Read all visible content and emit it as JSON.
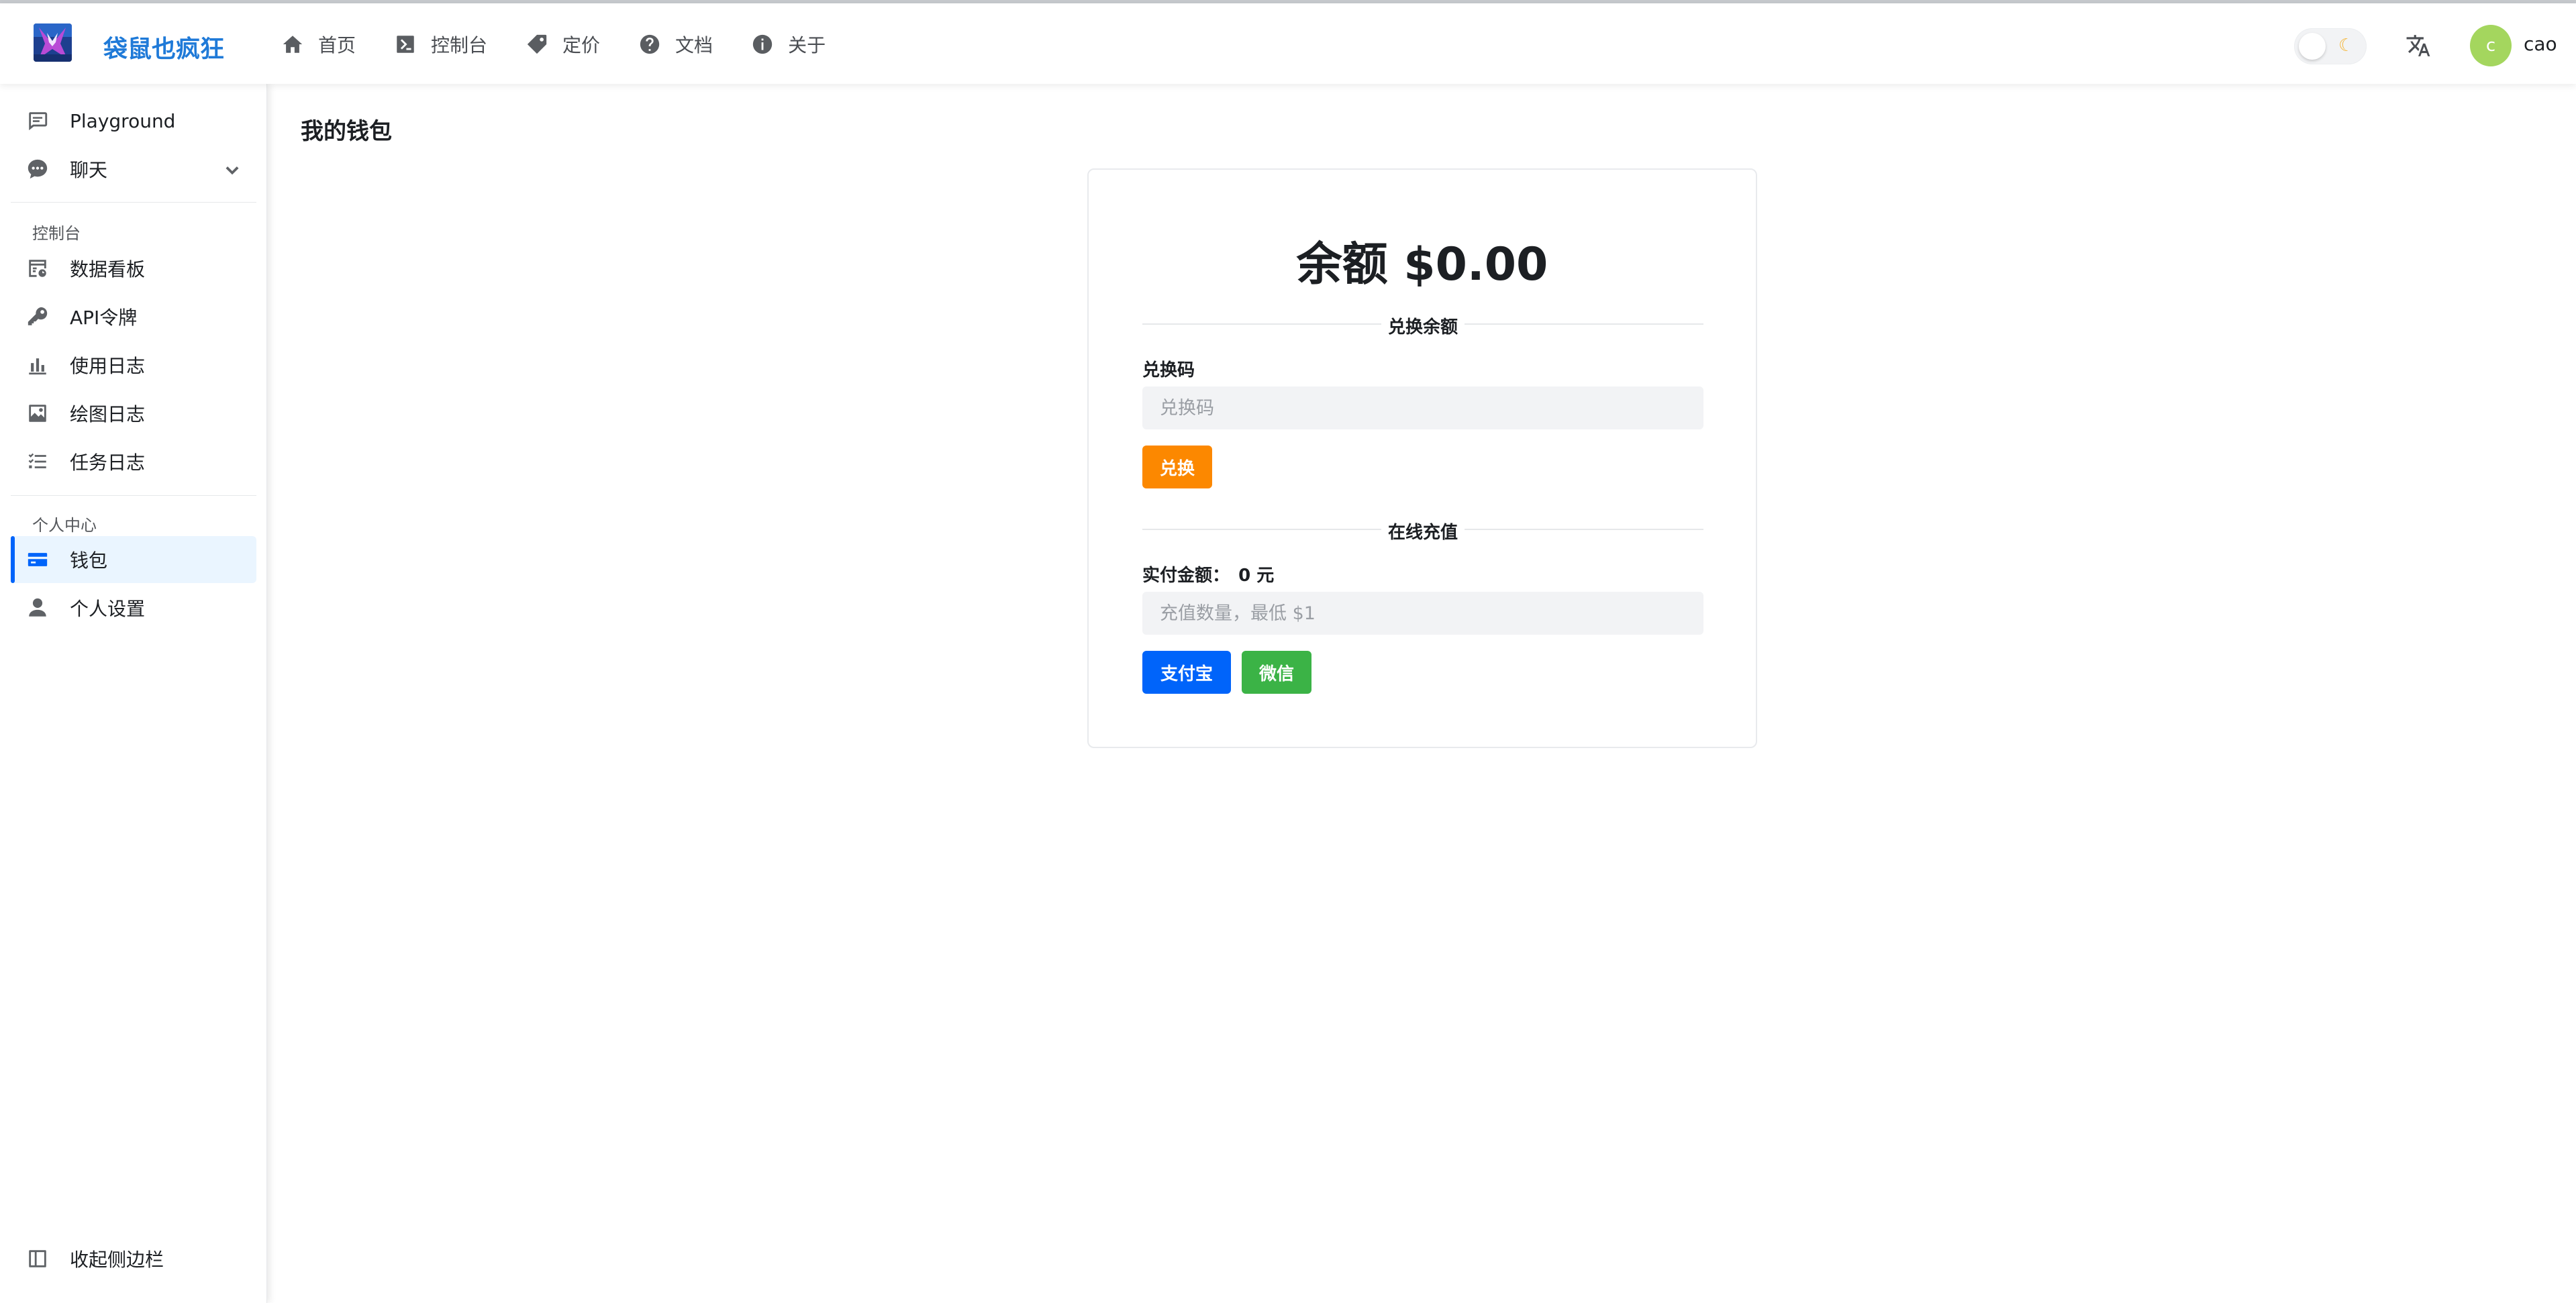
{
  "header": {
    "brand": "袋鼠也疯狂",
    "nav": [
      {
        "label": "首页",
        "icon": "home-icon"
      },
      {
        "label": "控制台",
        "icon": "terminal-icon"
      },
      {
        "label": "定价",
        "icon": "price-tag-icon"
      },
      {
        "label": "文档",
        "icon": "help-circle-icon"
      },
      {
        "label": "关于",
        "icon": "info-circle-icon"
      }
    ],
    "theme_icon": "moon-icon",
    "user": {
      "initial": "c",
      "name": "cao"
    },
    "avatar_color": "#a4d65e"
  },
  "sidebar": {
    "top_items": [
      {
        "label": "Playground",
        "icon": "comment-icon"
      },
      {
        "label": "聊天",
        "icon": "chat-bubble-icon"
      }
    ],
    "console_group": "控制台",
    "console_items": [
      {
        "label": "数据看板",
        "icon": "dashboard-icon"
      },
      {
        "label": "API令牌",
        "icon": "key-icon"
      },
      {
        "label": "使用日志",
        "icon": "bar-chart-icon"
      },
      {
        "label": "绘图日志",
        "icon": "image-icon"
      },
      {
        "label": "任务日志",
        "icon": "checklist-icon"
      }
    ],
    "personal_group": "个人中心",
    "personal_items": [
      {
        "label": "钱包",
        "icon": "credit-card-icon",
        "active": true
      },
      {
        "label": "个人设置",
        "icon": "user-icon"
      }
    ],
    "collapse_label": "收起侧边栏"
  },
  "main": {
    "page_title": "我的钱包",
    "balance": "余额 $0.00",
    "redeem": {
      "section_title": "兑换余额",
      "label": "兑换码",
      "placeholder": "兑换码",
      "button": "兑换"
    },
    "topup": {
      "section_title": "在线充值",
      "amount_label": "实付金额：",
      "amount_value": "0 元",
      "placeholder": "充值数量，最低 $1",
      "alipay_button": "支付宝",
      "wechat_button": "微信"
    }
  },
  "colors": {
    "brand": "#1f7ad8",
    "active_accent": "#0064fa",
    "redeem_button": "#fc8800",
    "alipay_button": "#0064fa",
    "wechat_button": "#3bb346"
  }
}
